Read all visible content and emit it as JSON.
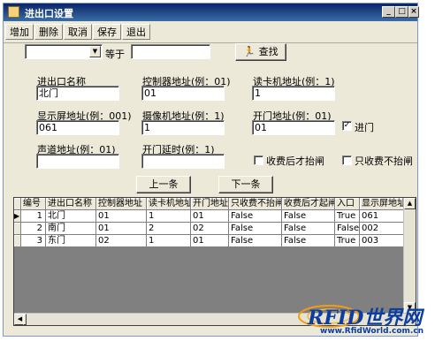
{
  "window": {
    "title": "进出口设置",
    "min": "_",
    "max": "□",
    "close": "×"
  },
  "toolbar": [
    "增加",
    "删除",
    "取消",
    "保存",
    "退出"
  ],
  "search": {
    "equals_label": "等于",
    "button": "查找",
    "field_value": "",
    "value": ""
  },
  "form": {
    "name_label": "进出口名称",
    "name_value": "北门",
    "controller_label": "控制器地址(例：01)",
    "controller_value": "01",
    "reader_label": "读卡机地址(例：1)",
    "reader_value": "1",
    "display_label": "显示屏地址(例：001)",
    "display_value": "061",
    "camera_label": "摄像机地址(例：1)",
    "camera_value": "1",
    "door_label": "开门地址(例：01)",
    "door_value": "01",
    "entry_label": "进门",
    "entry_checked": true,
    "voice_label": "声道地址(例：01)",
    "voice_value": "",
    "delay_label": "开门延时(例：1)",
    "delay_value": "",
    "charge_after_label": "收费后才抬闸",
    "charge_after_checked": false,
    "charge_only_label": "只收费不抬闸",
    "charge_only_checked": false
  },
  "nav": {
    "prev": "上一条",
    "next": "下一条"
  },
  "table": {
    "columns": [
      "编号",
      "进出口名称",
      "控制器地址",
      "读卡机地址",
      "开门地址",
      "只收费不抬闸",
      "收费后才起闸",
      "入口",
      "显示屏地址"
    ],
    "rows": [
      [
        "1",
        "北门",
        "01",
        "1",
        "01",
        "False",
        "False",
        "True",
        "061"
      ],
      [
        "2",
        "南门",
        "01",
        "2",
        "02",
        "False",
        "False",
        "False",
        "002"
      ],
      [
        "3",
        "东门",
        "02",
        "1",
        "01",
        "False",
        "False",
        "True",
        "003"
      ]
    ],
    "current_row_marker": "▶"
  },
  "watermark": {
    "text": "RFID世界网",
    "url": "www.RfidWorld.com.cn"
  },
  "colors": {
    "titlebar": "#0a246a",
    "window": "#ece9d8",
    "watermark": "#0b3ea0",
    "accent": "#f39c12"
  }
}
